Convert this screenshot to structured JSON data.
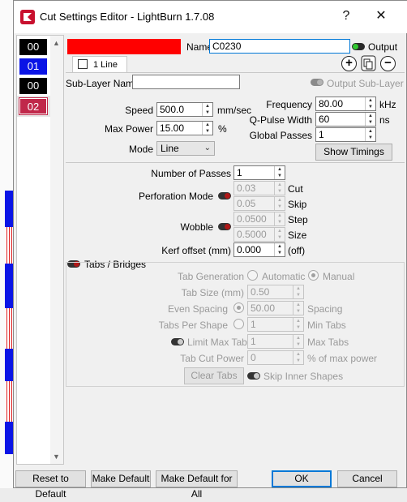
{
  "window": {
    "title": "Cut Settings Editor - LightBurn 1.7.08",
    "help": "?",
    "close": "✕"
  },
  "layers": [
    {
      "label": "00",
      "color": "#000000"
    },
    {
      "label": "01",
      "color": "#0a14e6"
    },
    {
      "label": "00",
      "color": "#000000"
    },
    {
      "label": "02",
      "color": "#c0284a"
    }
  ],
  "header": {
    "layer_color": "#ff0000",
    "name_label": "Name",
    "name_value": "C0230",
    "output_label": "Output",
    "sublayer_tab": "1 Line",
    "sublayer_name_label": "Sub-Layer Name",
    "sublayer_name_value": "",
    "output_sublayer_label": "Output Sub-Layer"
  },
  "params": {
    "speed_label": "Speed",
    "speed_value": "500.0",
    "speed_unit": "mm/sec",
    "maxpower_label": "Max Power",
    "maxpower_value": "15.00",
    "maxpower_unit": "%",
    "mode_label": "Mode",
    "mode_value": "Line",
    "frequency_label": "Frequency",
    "frequency_value": "80.00",
    "frequency_unit": "kHz",
    "qpulse_label": "Q-Pulse Width",
    "qpulse_value": "60",
    "qpulse_unit": "ns",
    "globalpasses_label": "Global Passes",
    "globalpasses_value": "1",
    "show_timings": "Show Timings"
  },
  "line": {
    "passes_label": "Number of Passes",
    "passes_value": "1",
    "perforation_label": "Perforation Mode",
    "cut_value": "0.03",
    "cut_label": "Cut",
    "skip_value": "0.05",
    "skip_label": "Skip",
    "wobble_label": "Wobble",
    "step_value": "0.0500",
    "step_label": "Step",
    "size_value": "0.5000",
    "size_label": "Size",
    "kerf_label": "Kerf offset (mm)",
    "kerf_value": "0.000",
    "kerf_suffix": "(off)"
  },
  "tabs": {
    "title": "Tabs / Bridges",
    "generation_label": "Tab Generation",
    "automatic": "Automatic",
    "manual": "Manual",
    "size_label": "Tab Size (mm)",
    "size_value": "0.50",
    "even_label": "Even Spacing",
    "spacing_value": "50.00",
    "spacing_label": "Spacing",
    "per_shape_label": "Tabs Per Shape",
    "min_tabs_value": "1",
    "min_tabs_label": "Min Tabs",
    "limit_label": "Limit Max Tabs",
    "max_tabs_value": "1",
    "max_tabs_label": "Max Tabs",
    "cut_power_label": "Tab Cut Power",
    "cut_power_value": "0",
    "cut_power_suffix": "% of max power",
    "clear_tabs": "Clear Tabs",
    "skip_inner": "Skip Inner Shapes"
  },
  "footer": {
    "reset": "Reset to Default",
    "make_default": "Make Default",
    "make_default_all": "Make Default for All",
    "ok": "OK",
    "cancel": "Cancel"
  }
}
